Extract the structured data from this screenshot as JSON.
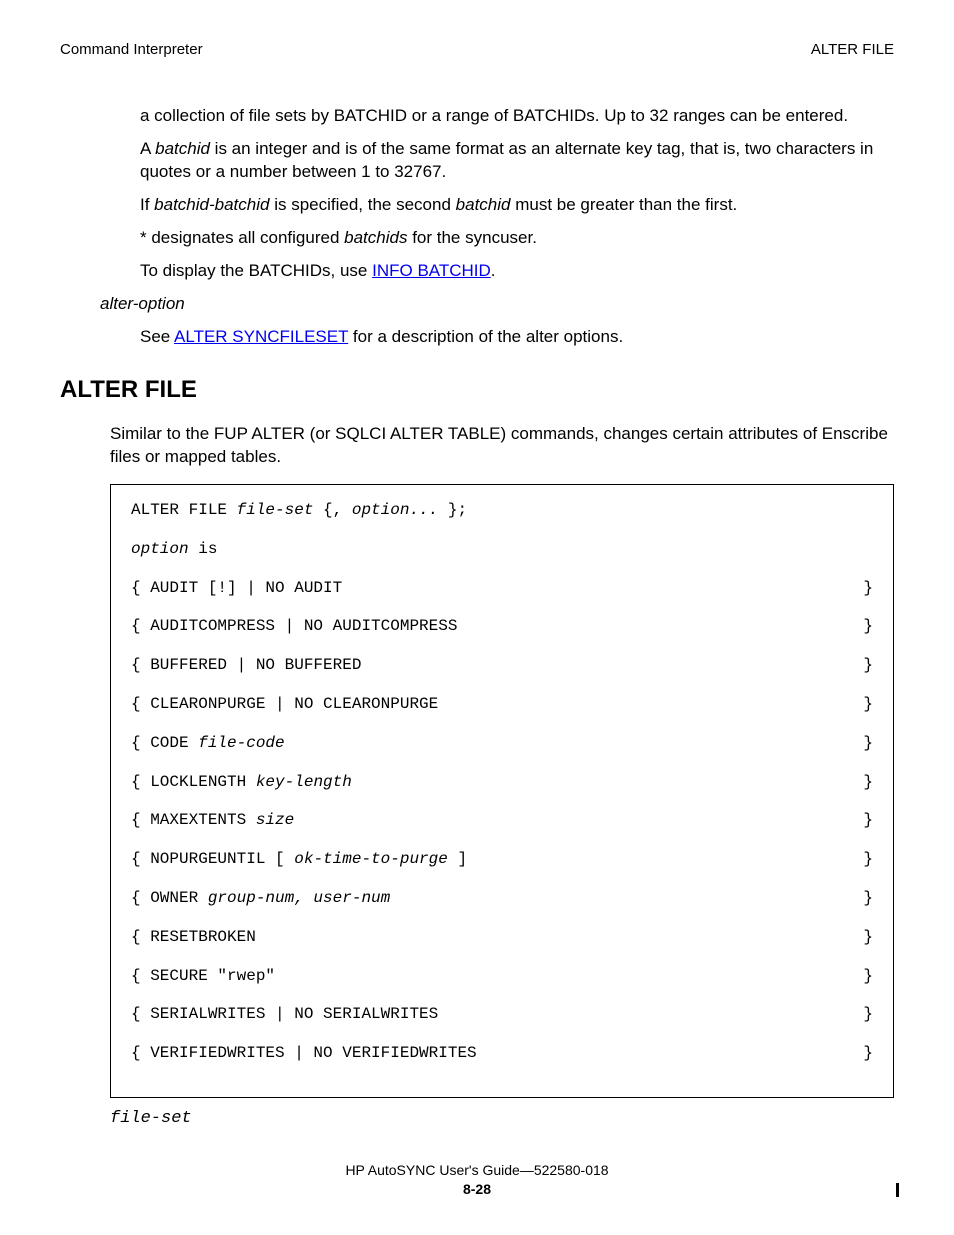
{
  "header": {
    "left": "Command Interpreter",
    "right": "ALTER FILE"
  },
  "p1": "a collection of file sets by BATCHID or a range of BATCHIDs. Up to 32 ranges can be entered.",
  "p2a": "A ",
  "p2b": "batchid",
  "p2c": " is an integer and is of the same format as an alternate key tag, that is, two characters in quotes or a number between 1 to 32767.",
  "p3a": "If ",
  "p3b": "batchid-batchid",
  "p3c": " is specified, the second ",
  "p3d": "batchid",
  "p3e": " must be greater than the first.",
  "p4a": "* designates all configured ",
  "p4b": "batchids",
  "p4c": " for the syncuser.",
  "p5a": "To display the BATCHIDs, use ",
  "p5link": "INFO BATCHID",
  "p5b": ".",
  "alterOption": "alter-option",
  "p6a": "See ",
  "p6link": "ALTER SYNCFILESET",
  "p6b": " for a description of the alter options.",
  "sectionTitle": "ALTER FILE",
  "sectionDesc": "Similar to the FUP ALTER (or SQLCI ALTER TABLE) commands, changes certain attributes of Enscribe files or mapped tables.",
  "syntax": {
    "line1a": " ALTER FILE ",
    "line1b": "file-set",
    "line1c": " {, ",
    "line1d": "option...",
    "line1e": " };",
    "line2a": " option",
    "line2b": " is",
    "rows": [
      {
        "l": "{ AUDIT [!] | NO AUDIT",
        "r": "}"
      },
      {
        "l": "{ AUDITCOMPRESS | NO AUDITCOMPRESS",
        "r": "}"
      },
      {
        "l": "{ BUFFERED | NO BUFFERED",
        "r": "}"
      },
      {
        "l": "{ CLEARONPURGE | NO CLEARONPURGE",
        "r": "}"
      },
      {
        "l": "{ CODE <i>file-code</i>",
        "r": "}"
      },
      {
        "l": "{ LOCKLENGTH <i>key-length</i>",
        "r": "}"
      },
      {
        "l": "{ MAXEXTENTS <i>size</i>",
        "r": "}"
      },
      {
        "l": "{ NOPURGEUNTIL [ <i>ok-time-to-purge</i> ]",
        "r": "}"
      },
      {
        "l": "{ OWNER <i>group-num, user-num</i>",
        "r": "}"
      },
      {
        "l": "{ RESETBROKEN",
        "r": "}"
      },
      {
        "l": "{ SECURE \"rwep\"",
        "r": "}"
      },
      {
        "l": "{ SERIALWRITES | NO SERIALWRITES",
        "r": "}"
      },
      {
        "l": "{ VERIFIEDWRITES | NO VERIFIEDWRITES",
        "r": "}"
      }
    ]
  },
  "fileSetLabel": "file-set",
  "footer": {
    "title": "HP AutoSYNC User's Guide—522580-018",
    "page": "8-28"
  }
}
